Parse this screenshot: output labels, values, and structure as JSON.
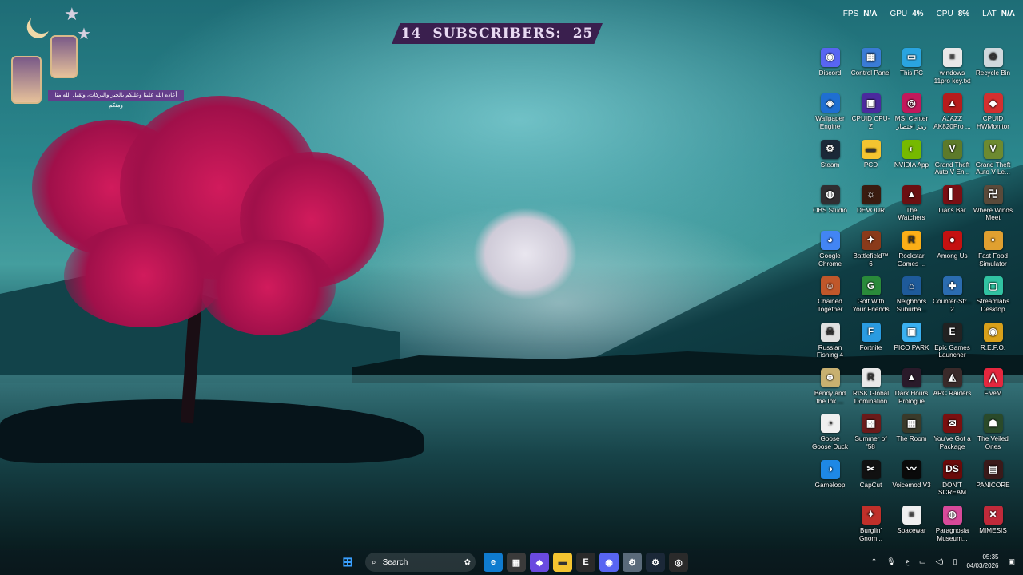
{
  "overlay": {
    "subscribers_label": "SUBSCRIBERS:",
    "subscribers_left": "14",
    "subscribers_right": "25",
    "arabic_banner": "أعاده الله علينا وعليكم بالخير والبركات، وتقبل الله منا ومنكم"
  },
  "stats": [
    {
      "label": "FPS",
      "value": "N/A"
    },
    {
      "label": "GPU",
      "value": "4%"
    },
    {
      "label": "CPU",
      "value": "8%"
    },
    {
      "label": "LAT",
      "value": "N/A"
    }
  ],
  "desktop_icons": [
    {
      "label": "Discord",
      "icon": "discord-icon",
      "color": "#5865f2",
      "glyph": "◉"
    },
    {
      "label": "Control Panel",
      "icon": "control-panel-icon",
      "color": "#3a7bd5",
      "glyph": "▦"
    },
    {
      "label": "This PC",
      "icon": "this-pc-icon",
      "color": "#2aa4e0",
      "glyph": "▭"
    },
    {
      "label": "windows 11pro key.txt",
      "icon": "text-file-icon",
      "color": "#e8e8e8",
      "glyph": "≡"
    },
    {
      "label": "Recycle Bin",
      "icon": "recycle-bin-icon",
      "color": "#cfd8dc",
      "glyph": "♻"
    },
    {
      "label": "Wallpaper Engine",
      "icon": "wallpaper-engine-icon",
      "color": "#1f6fd1",
      "glyph": "◈"
    },
    {
      "label": "CPUID CPU-Z",
      "icon": "cpu-z-icon",
      "color": "#4b2a9e",
      "glyph": "▣"
    },
    {
      "label": "MSI Center رمز اختصار",
      "icon": "msi-center-icon",
      "color": "#c2185b",
      "glyph": "◎"
    },
    {
      "label": "AJAZZ AK820Pro ...",
      "icon": "ajazz-icon",
      "color": "#b71c1c",
      "glyph": "▲"
    },
    {
      "label": "CPUID HWMonitor",
      "icon": "hwmonitor-icon",
      "color": "#d32f2f",
      "glyph": "◆"
    },
    {
      "label": "Steam",
      "icon": "steam-icon",
      "color": "#1b2838",
      "glyph": "⚙"
    },
    {
      "label": "PCD",
      "icon": "folder-icon",
      "color": "#f4c430",
      "glyph": "▬"
    },
    {
      "label": "NVIDIA App",
      "icon": "nvidia-icon",
      "color": "#76b900",
      "glyph": "◐"
    },
    {
      "label": "Grand Theft Auto V En...",
      "icon": "gta-v-icon",
      "color": "#5d7a2a",
      "glyph": "V"
    },
    {
      "label": "Grand Theft Auto V Le...",
      "icon": "gta-v-legacy-icon",
      "color": "#6d8a30",
      "glyph": "V"
    },
    {
      "label": "OBS Studio",
      "icon": "obs-icon",
      "color": "#302e31",
      "glyph": "◍"
    },
    {
      "label": "DEVOUR",
      "icon": "devour-icon",
      "color": "#3a1c10",
      "glyph": "☼"
    },
    {
      "label": "The Watchers",
      "icon": "the-watchers-icon",
      "color": "#6b0f12",
      "glyph": "▲"
    },
    {
      "label": "Liar's Bar",
      "icon": "liars-bar-icon",
      "color": "#7a0f14",
      "glyph": "▌"
    },
    {
      "label": "Where Winds Meet",
      "icon": "where-winds-meet-icon",
      "color": "#5a4a3a",
      "glyph": "卍"
    },
    {
      "label": "Google Chrome",
      "icon": "chrome-icon",
      "color": "#4285f4",
      "glyph": "◕"
    },
    {
      "label": "Battlefield™ 6",
      "icon": "battlefield-icon",
      "color": "#8a3a1a",
      "glyph": "✦"
    },
    {
      "label": "Rockstar Games ...",
      "icon": "rockstar-icon",
      "color": "#fcaf17",
      "glyph": "R"
    },
    {
      "label": "Among Us",
      "icon": "among-us-icon",
      "color": "#c51111",
      "glyph": "●"
    },
    {
      "label": "Fast Food Simulator",
      "icon": "fast-food-simulator-icon",
      "color": "#e0a030",
      "glyph": "▪"
    },
    {
      "label": "Chained Together",
      "icon": "chained-together-icon",
      "color": "#c0572a",
      "glyph": "☺"
    },
    {
      "label": "Golf With Your Friends",
      "icon": "golf-icon",
      "color": "#2a8a3a",
      "glyph": "G"
    },
    {
      "label": "Neighbors Suburba...",
      "icon": "neighbors-icon",
      "color": "#1e5a9a",
      "glyph": "⌂"
    },
    {
      "label": "Counter-Str... 2",
      "icon": "counter-strike-icon",
      "color": "#2b6cb0",
      "glyph": "✚"
    },
    {
      "label": "Streamlabs Desktop",
      "icon": "streamlabs-icon",
      "color": "#31c3a2",
      "glyph": "▢"
    },
    {
      "label": "Russian Fishing 4",
      "icon": "russian-fishing-icon",
      "color": "#e0e0e0",
      "glyph": "☠"
    },
    {
      "label": "Fortnite",
      "icon": "fortnite-icon",
      "color": "#2a9be0",
      "glyph": "F"
    },
    {
      "label": "PICO PARK",
      "icon": "pico-park-icon",
      "color": "#3ab0f0",
      "glyph": "▣"
    },
    {
      "label": "Epic Games Launcher",
      "icon": "epic-games-icon",
      "color": "#222",
      "glyph": "E"
    },
    {
      "label": "R.E.P.O.",
      "icon": "repo-icon",
      "color": "#d8a01a",
      "glyph": "◉"
    },
    {
      "label": "Bendy and the Ink ...",
      "icon": "bendy-icon",
      "color": "#c8b070",
      "glyph": "☻"
    },
    {
      "label": "RISK Global Domination",
      "icon": "risk-icon",
      "color": "#e8e8e8",
      "glyph": "R"
    },
    {
      "label": "Dark Hours Prologue",
      "icon": "dark-hours-icon",
      "color": "#2a1a2a",
      "glyph": "▲"
    },
    {
      "label": "ARC Raiders",
      "icon": "arc-raiders-icon",
      "color": "#3a2a2a",
      "glyph": "◭"
    },
    {
      "label": "FiveM",
      "icon": "fivem-icon",
      "color": "#e5273e",
      "glyph": "⋀"
    },
    {
      "label": "Goose Goose Duck",
      "icon": "goose-goose-duck-icon",
      "color": "#f0f0f0",
      "glyph": "◔"
    },
    {
      "label": "Summer of '58",
      "icon": "summer-of-58-icon",
      "color": "#6a1a1a",
      "glyph": "▩"
    },
    {
      "label": "The Room",
      "icon": "the-room-icon",
      "color": "#3a3a2a",
      "glyph": "▦"
    },
    {
      "label": "You've Got a Package",
      "icon": "package-icon",
      "color": "#7a1010",
      "glyph": "✉"
    },
    {
      "label": "The Veiled Ones",
      "icon": "veiled-ones-icon",
      "color": "#2a4a2a",
      "glyph": "☗"
    },
    {
      "label": "Gameloop",
      "icon": "gameloop-icon",
      "color": "#1e88e5",
      "glyph": "◑"
    },
    {
      "label": "CapCut",
      "icon": "capcut-icon",
      "color": "#111",
      "glyph": "✂"
    },
    {
      "label": "Voicemod V3",
      "icon": "voicemod-icon",
      "color": "#0a0a0a",
      "glyph": "〰"
    },
    {
      "label": "DON'T SCREAM",
      "icon": "dont-scream-icon",
      "color": "#6a0a0a",
      "glyph": "DS"
    },
    {
      "label": "PANICORE",
      "icon": "panicore-icon",
      "color": "#3a1a1a",
      "glyph": "▤"
    },
    {
      "label": "",
      "icon": "empty-slot",
      "color": "",
      "glyph": ""
    },
    {
      "label": "Burglin' Gnom...",
      "icon": "burglin-gnomes-icon",
      "color": "#c0302a",
      "glyph": "✦"
    },
    {
      "label": "Spacewar",
      "icon": "spacewar-icon",
      "color": "#f0f0f0",
      "glyph": "≡"
    },
    {
      "label": "Paragnosia Museum...",
      "icon": "paragnosia-icon",
      "color": "#d84a9a",
      "glyph": "◍"
    },
    {
      "label": "MIMESIS",
      "icon": "mimesis-icon",
      "color": "#c02a3a",
      "glyph": "✕"
    }
  ],
  "taskbar": {
    "search_placeholder": "Search",
    "apps": [
      {
        "name": "edge-icon",
        "color": "#0f7bcf",
        "glyph": "e"
      },
      {
        "name": "store-icon",
        "color": "#3a3a3a",
        "glyph": "▦"
      },
      {
        "name": "copilot-icon",
        "color": "#6a4ae0",
        "glyph": "◆"
      },
      {
        "name": "file-explorer-icon",
        "color": "#f4c430",
        "glyph": "▬"
      },
      {
        "name": "epic-games-icon",
        "color": "#2a2a2a",
        "glyph": "E"
      },
      {
        "name": "discord-icon",
        "color": "#5865f2",
        "glyph": "◉"
      },
      {
        "name": "settings-icon",
        "color": "#5a6a7a",
        "glyph": "⚙"
      },
      {
        "name": "steam-icon",
        "color": "#1b2838",
        "glyph": "⚙"
      },
      {
        "name": "rockstar-icon",
        "color": "#2a2a2a",
        "glyph": "◎"
      }
    ],
    "lang": "ع",
    "time": "05:35",
    "date": "04/03/2026"
  }
}
